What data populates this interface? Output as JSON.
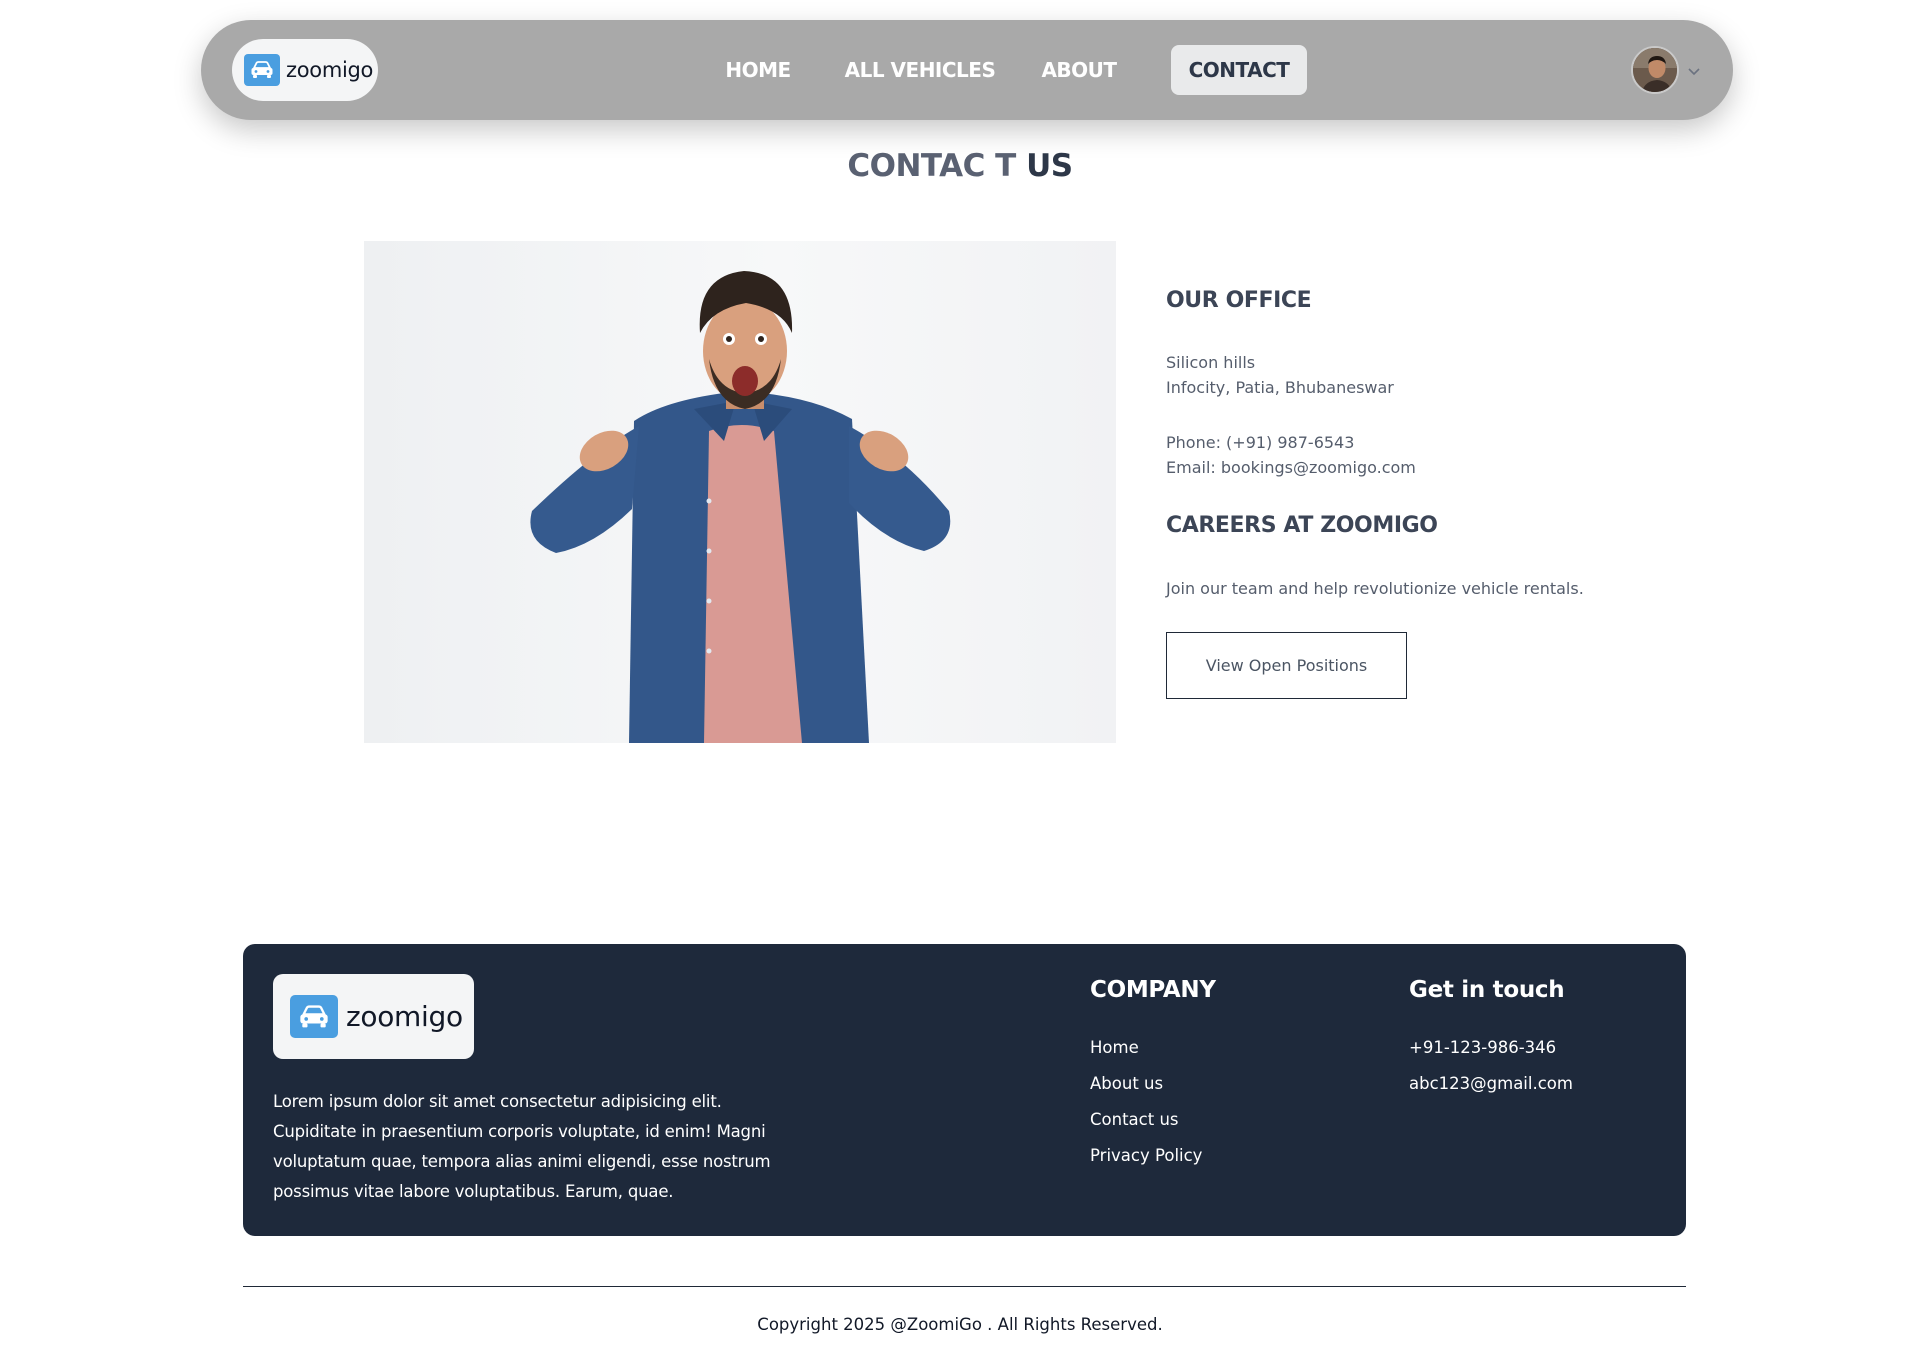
{
  "brand": {
    "name": "zoomigo",
    "accent": "#4a9ee0"
  },
  "nav": {
    "items": [
      {
        "label": "HOME"
      },
      {
        "label": "ALL VEHICLES"
      },
      {
        "label": "ABOUT"
      },
      {
        "label": "CONTACT",
        "active": true
      }
    ]
  },
  "page": {
    "title_light": "CONTAC T ",
    "title_bold": "US"
  },
  "office": {
    "title": "OUR OFFICE",
    "address_line1": "Silicon hills",
    "address_line2": "Infocity, Patia, Bhubaneswar",
    "phone": "Phone: (+91) 987-6543",
    "email": "Email: bookings@zoomigo.com"
  },
  "careers": {
    "title": "CAREERS AT ZOOMIGO",
    "text": "Join our team and help revolutionize vehicle rentals.",
    "button_label": "View Open Positions"
  },
  "footer": {
    "logo_text": "zoomigo",
    "description": "Lorem ipsum dolor sit amet consectetur adipisicing elit. Cupiditate in praesentium corporis voluptate, id enim! Magni voluptatum quae, tempora alias animi eligendi, esse nostrum possimus vitae labore voluptatibus. Earum, quae.",
    "company_title": "COMPANY",
    "company_links": [
      "Home",
      "About us",
      "Contact us",
      "Privacy Policy"
    ],
    "contact_title": "Get in touch",
    "phone": "+91-123-986-346",
    "email": "abc123@gmail.com",
    "background": "#1e293b"
  },
  "copyright": "Copyright 2025 @ZoomiGo . All Rights Reserved."
}
